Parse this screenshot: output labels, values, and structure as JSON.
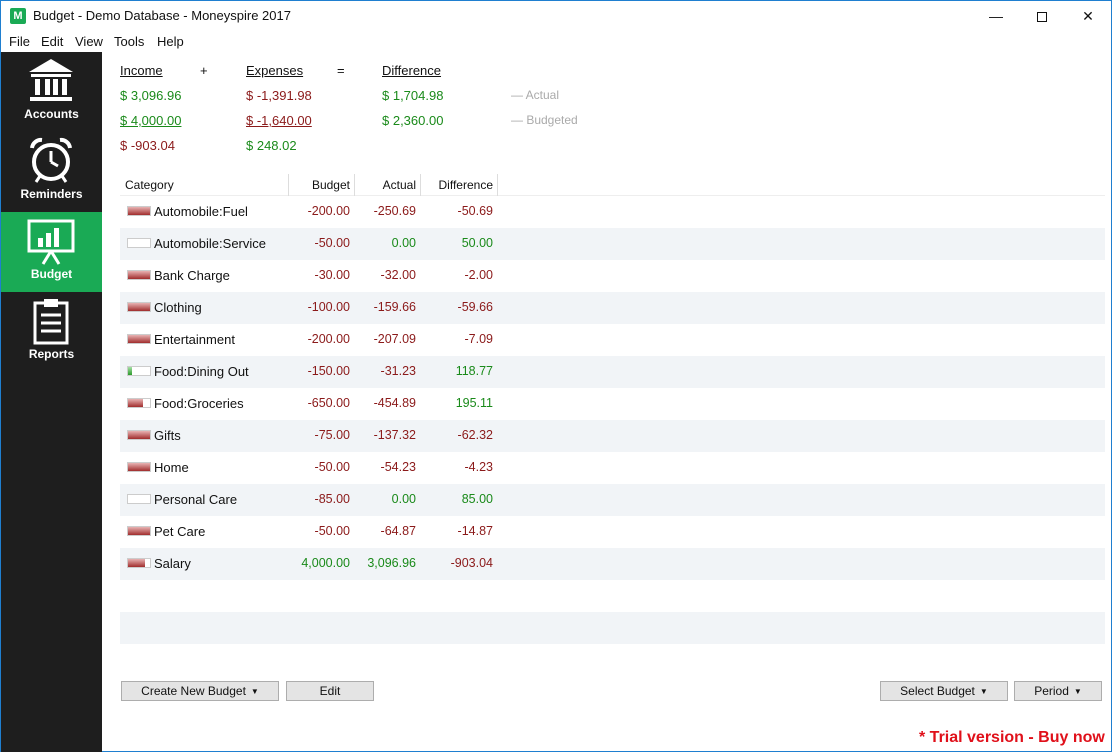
{
  "window": {
    "app_icon": "M",
    "title": "Budget - Demo Database - Moneyspire 2017",
    "min_glyph": "—",
    "close_glyph": "✕"
  },
  "menu": [
    "File",
    "Edit",
    "View",
    "Tools",
    "Help"
  ],
  "sidebar": [
    {
      "label": "Accounts",
      "icon": "bank-icon",
      "active": false
    },
    {
      "label": "Reminders",
      "icon": "alarm-clock-icon",
      "active": false
    },
    {
      "label": "Budget",
      "icon": "presentation-chart-icon",
      "active": true
    },
    {
      "label": "Reports",
      "icon": "clipboard-icon",
      "active": false
    }
  ],
  "summary": {
    "headers": {
      "income": "Income",
      "plus": "+",
      "expenses": "Expenses",
      "equals": "=",
      "difference": "Difference"
    },
    "actual": {
      "income": "$ 3,096.96",
      "expenses": "$ -1,391.98",
      "difference": "$ 1,704.98",
      "label": "— Actual"
    },
    "budgeted": {
      "income": "$ 4,000.00",
      "expenses": "$ -1,640.00",
      "difference": "$ 2,360.00",
      "label": "— Budgeted"
    },
    "variance": {
      "income": "$ -903.04",
      "expenses": "$ 248.02"
    }
  },
  "table": {
    "columns": {
      "category": "Category",
      "budget": "Budget",
      "actual": "Actual",
      "difference": "Difference"
    },
    "rows": [
      {
        "category": "Automobile:Fuel",
        "budget": "-200.00",
        "actual": "-250.69",
        "difference": "-50.69",
        "fill": 1.0,
        "fill_color": "red"
      },
      {
        "category": "Automobile:Service",
        "budget": "-50.00",
        "actual": "0.00",
        "difference": "50.00",
        "fill": 0,
        "fill_color": "red"
      },
      {
        "category": "Bank Charge",
        "budget": "-30.00",
        "actual": "-32.00",
        "difference": "-2.00",
        "fill": 1.0,
        "fill_color": "red"
      },
      {
        "category": "Clothing",
        "budget": "-100.00",
        "actual": "-159.66",
        "difference": "-59.66",
        "fill": 1.0,
        "fill_color": "red"
      },
      {
        "category": "Entertainment",
        "budget": "-200.00",
        "actual": "-207.09",
        "difference": "-7.09",
        "fill": 1.0,
        "fill_color": "red"
      },
      {
        "category": "Food:Dining Out",
        "budget": "-150.00",
        "actual": "-31.23",
        "difference": "118.77",
        "fill": 0.2,
        "fill_color": "green"
      },
      {
        "category": "Food:Groceries",
        "budget": "-650.00",
        "actual": "-454.89",
        "difference": "195.11",
        "fill": 0.7,
        "fill_color": "red"
      },
      {
        "category": "Gifts",
        "budget": "-75.00",
        "actual": "-137.32",
        "difference": "-62.32",
        "fill": 1.0,
        "fill_color": "red"
      },
      {
        "category": "Home",
        "budget": "-50.00",
        "actual": "-54.23",
        "difference": "-4.23",
        "fill": 1.0,
        "fill_color": "red"
      },
      {
        "category": "Personal Care",
        "budget": "-85.00",
        "actual": "0.00",
        "difference": "85.00",
        "fill": 0,
        "fill_color": "red"
      },
      {
        "category": "Pet Care",
        "budget": "-50.00",
        "actual": "-64.87",
        "difference": "-14.87",
        "fill": 1.0,
        "fill_color": "red"
      },
      {
        "category": "Salary",
        "budget": "4,000.00",
        "actual": "3,096.96",
        "difference": "-903.04",
        "fill": 0.77,
        "fill_color": "red"
      }
    ]
  },
  "buttons": {
    "create": "Create New Budget",
    "edit": "Edit",
    "select": "Select Budget",
    "period": "Period",
    "caret": "▼"
  },
  "trial": "* Trial version - Buy now",
  "colors": {
    "accent": "#1aaa55",
    "positive": "#1a8a1a",
    "negative": "#8b1a1a",
    "trial": "#e0101a",
    "sidebar": "#1e1e1e"
  }
}
